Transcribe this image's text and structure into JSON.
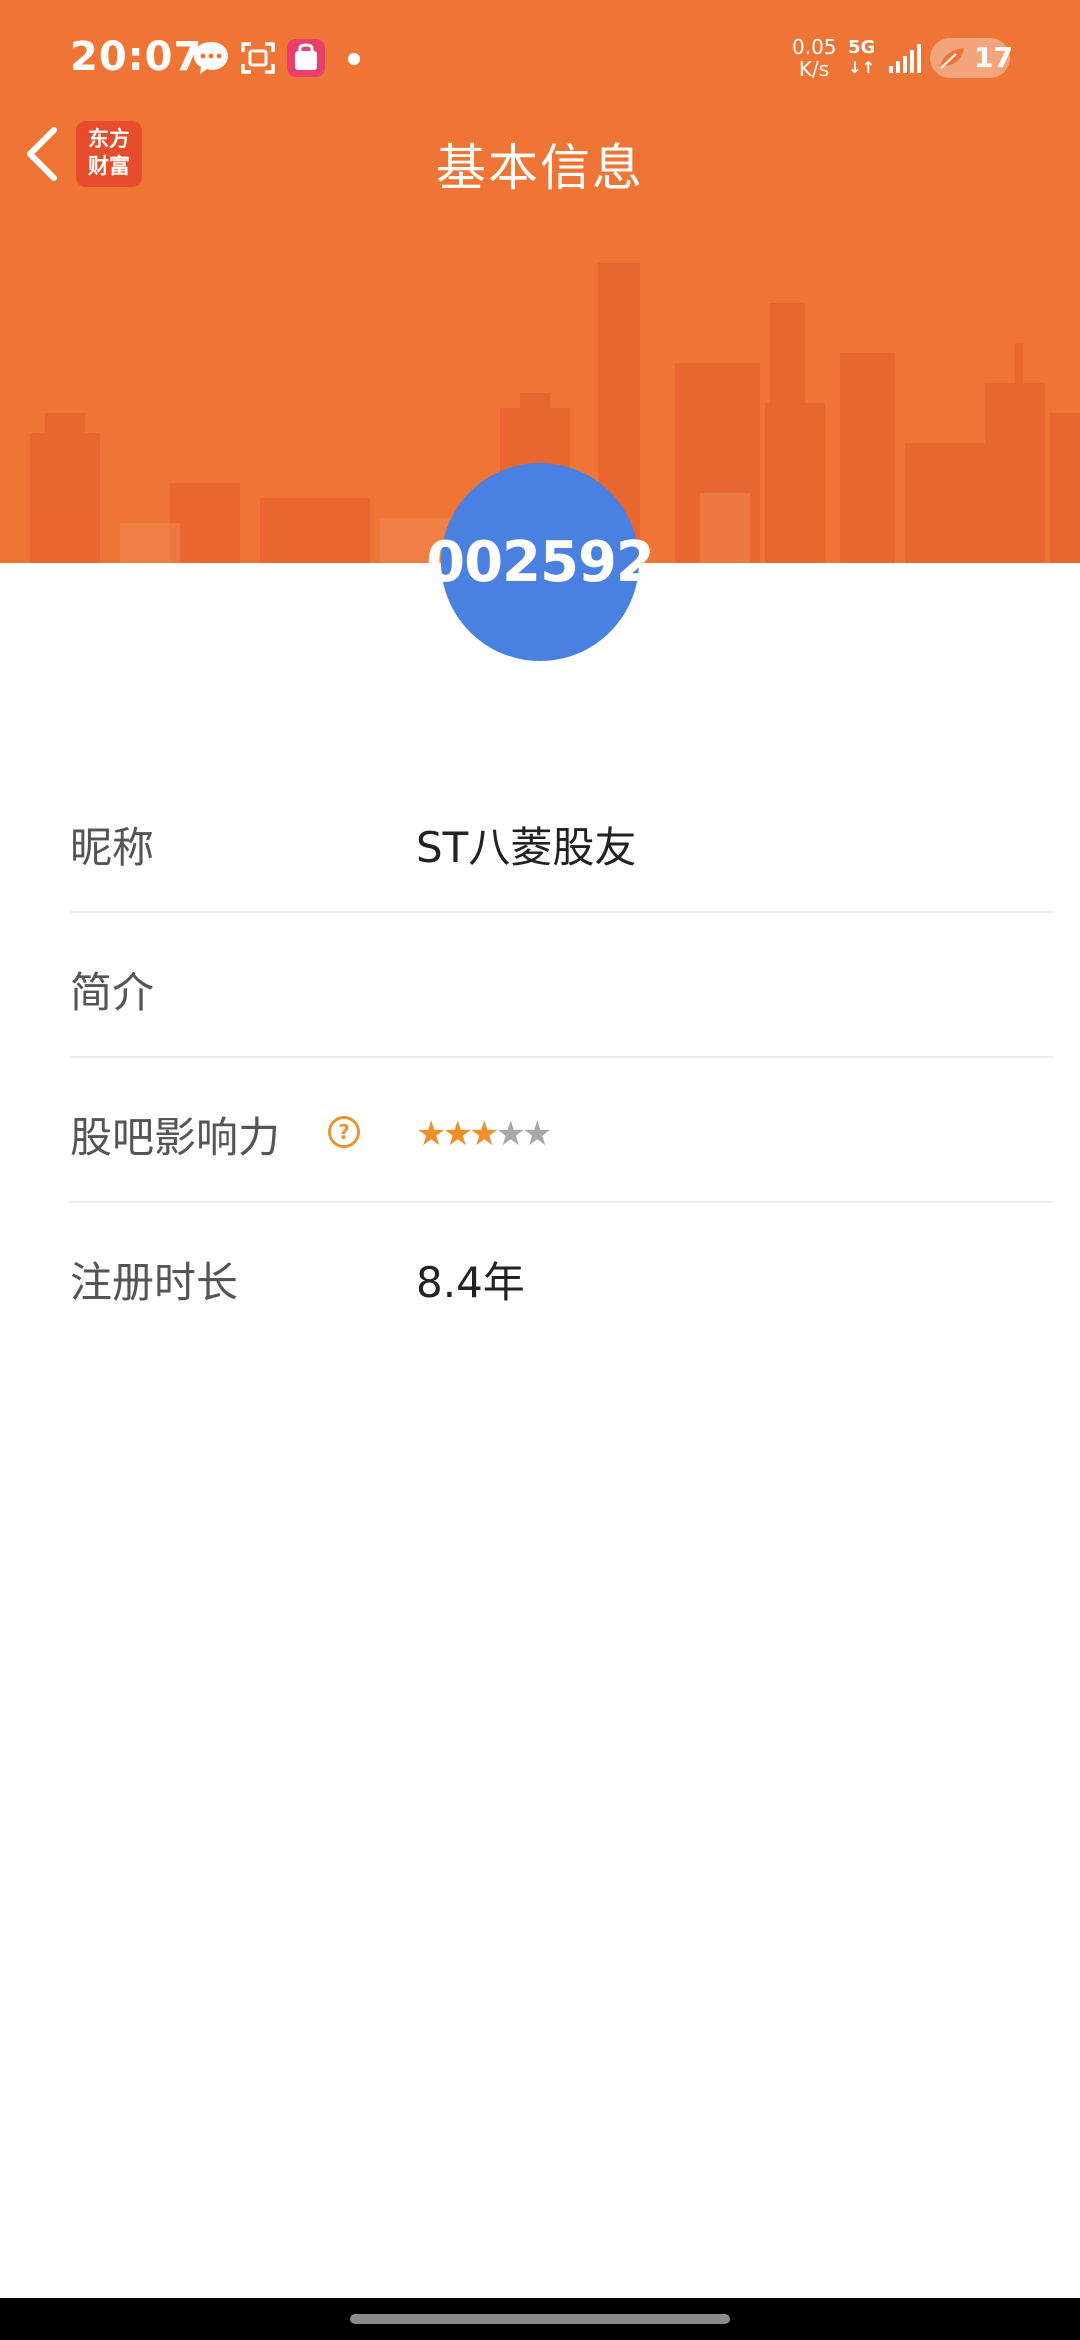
{
  "status_bar": {
    "time": "20:07",
    "net_speed_value": "0.05",
    "net_speed_unit": "K/s",
    "network_type": "5G",
    "battery_level": "17",
    "icons": [
      "message-bubble-icon",
      "scan-icon",
      "shopping-bag-icon",
      "notification-dot-icon",
      "signal-icon",
      "battery-saver-icon"
    ]
  },
  "header": {
    "title": "基本信息",
    "logo_line1": "东方",
    "logo_line2": "财富",
    "back_icon": "chevron-left-icon"
  },
  "avatar": {
    "text": "002592"
  },
  "info": {
    "rows": [
      {
        "label": "昵称",
        "value": "ST八菱股友"
      },
      {
        "label": "简介",
        "value": ""
      },
      {
        "label": "股吧影响力",
        "help_icon": "?",
        "rating": 3,
        "rating_max": 5
      },
      {
        "label": "注册时长",
        "value": "8.4年"
      }
    ]
  },
  "colors": {
    "header_orange": "#ee7535",
    "avatar_blue": "#4a80e0",
    "star_active": "#f0902a",
    "star_inactive": "#a8a8a8",
    "help_icon": "#e99436"
  }
}
